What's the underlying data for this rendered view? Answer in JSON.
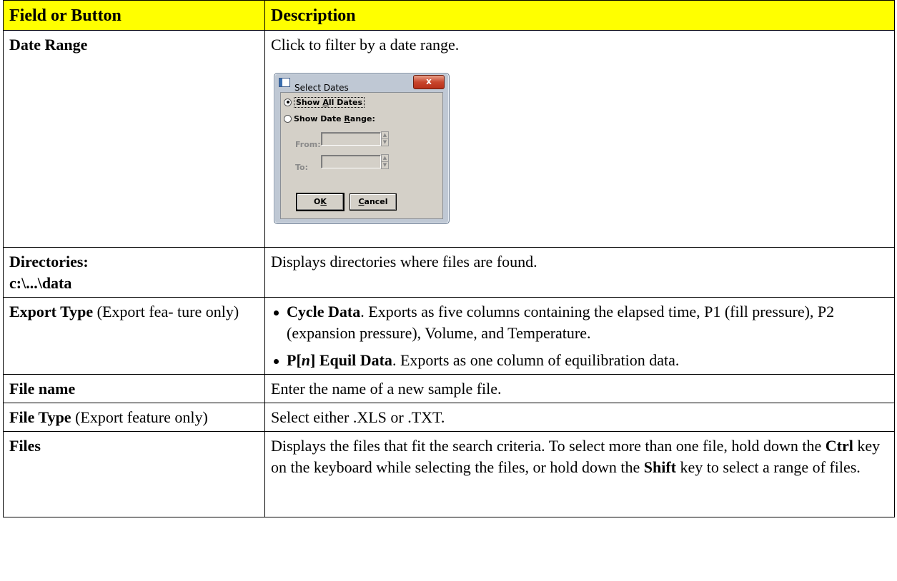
{
  "table": {
    "headers": [
      "Field or Button",
      "Description"
    ],
    "rows": {
      "date_range": {
        "field": "Date Range",
        "desc": "Click to filter by a date range."
      },
      "directories": {
        "field_line1": "Directories:",
        "field_line2": "c:\\...\\data",
        "desc": "Displays directories where files are found."
      },
      "export_type": {
        "field_bold": "Export Type",
        "field_rest": " (Export fea- ture only)",
        "bullet1_bold": "Cycle Data",
        "bullet1_text": ". Exports as five columns containing the elapsed time, P1 (fill pressure), P2 (expansion pressure), Volume, and Temperature.",
        "bullet2_bold_a": "P[",
        "bullet2_bold_n": "n",
        "bullet2_bold_b": "] Equil Data",
        "bullet2_text": ". Exports as one column of equilibration data."
      },
      "file_name": {
        "field": "File name",
        "desc": "Enter the name of a new sample file."
      },
      "file_type": {
        "field_bold": "File Type",
        "field_rest": " (Export feature only)",
        "desc": "Select either .XLS or .TXT."
      },
      "files": {
        "field": "Files",
        "desc_1": "Displays the files that fit the search criteria. To select more than one file, hold down the ",
        "desc_ctrl": "Ctrl",
        "desc_2": " key on the keyboard while selecting the files, or hold down the ",
        "desc_shift": "Shift",
        "desc_3": " key to select a range of files."
      }
    }
  },
  "dialog": {
    "title": "Select Dates",
    "close_glyph": "x",
    "radio_all_pre": "Show ",
    "radio_all_u": "A",
    "radio_all_post": "ll Dates",
    "radio_range_pre": "Show Date ",
    "radio_range_u": "R",
    "radio_range_post": "ange:",
    "from_label": "From:",
    "to_label": "To:",
    "ok_pre": "O",
    "ok_u": "K",
    "cancel_u": "C",
    "cancel_post": "ancel",
    "selected": "show_all_dates"
  }
}
